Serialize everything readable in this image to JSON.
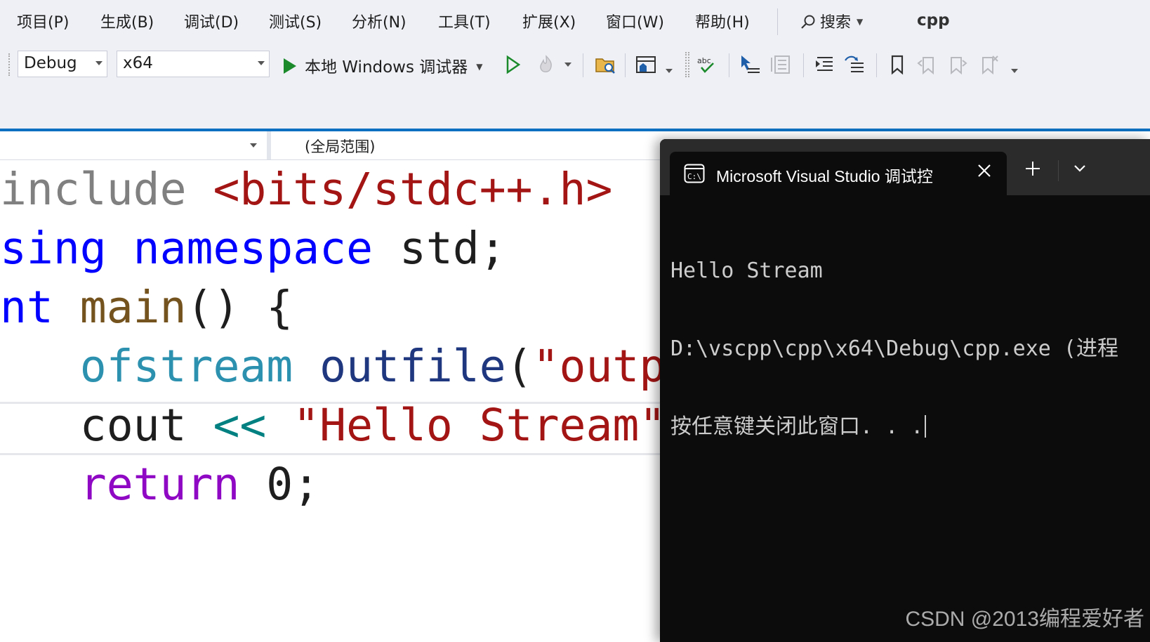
{
  "menu": {
    "items": [
      "项目(P)",
      "生成(B)",
      "调试(D)",
      "测试(S)",
      "分析(N)",
      "工具(T)",
      "扩展(X)",
      "窗口(W)",
      "帮助(H)"
    ],
    "search_label": "搜索",
    "solution_name": "cpp"
  },
  "toolbar": {
    "config_value": "Debug",
    "platform_value": "x64",
    "debugger_label": "本地 Windows 调试器",
    "icons": [
      "start-without-debugging-icon",
      "hot-reload-icon",
      "open-folder-icon",
      "window-layout-icon",
      "spell-check-icon",
      "set-next-statement-icon",
      "show-next-statement-icon",
      "indent-icon",
      "comment-icon",
      "bookmark-icon",
      "prev-bookmark-icon",
      "next-bookmark-icon",
      "clear-bookmarks-icon"
    ]
  },
  "navbar": {
    "scope": "(全局范围)"
  },
  "editor": {
    "lines": [
      [
        {
          "t": "include ",
          "c": "pre"
        },
        {
          "t": "<bits/stdc++.h>",
          "c": "inc"
        }
      ],
      [
        {
          "t": "sing ",
          "c": "kw"
        },
        {
          "t": "namespace",
          "c": "kw"
        },
        {
          "t": " std;",
          "c": "plain"
        }
      ],
      [
        {
          "t": "nt",
          "c": "kw"
        },
        {
          "t": " ",
          "c": "plain"
        },
        {
          "t": "main",
          "c": "fn"
        },
        {
          "t": "() {",
          "c": "plain"
        }
      ],
      [
        {
          "t": "   ",
          "c": "plain"
        },
        {
          "t": "ofstream",
          "c": "type"
        },
        {
          "t": " ",
          "c": "plain"
        },
        {
          "t": "outfile",
          "c": "var"
        },
        {
          "t": "(",
          "c": "plain"
        },
        {
          "t": "\"outpu",
          "c": "str"
        }
      ],
      [
        {
          "t": "   cout ",
          "c": "plain"
        },
        {
          "t": "<<",
          "c": "op"
        },
        {
          "t": " ",
          "c": "plain"
        },
        {
          "t": "\"Hello Stream\"",
          "c": "str"
        },
        {
          "t": ";",
          "c": "plain"
        }
      ],
      [
        {
          "t": "   ",
          "c": "plain"
        },
        {
          "t": "return",
          "c": "ctl"
        },
        {
          "t": " 0;",
          "c": "plain"
        }
      ]
    ]
  },
  "terminal": {
    "tab_title": "Microsoft Visual Studio 调试控",
    "output": [
      "Hello Stream",
      "D:\\vscpp\\cpp\\x64\\Debug\\cpp.exe (进程",
      "按任意键关闭此窗口. . ."
    ]
  },
  "watermark": "CSDN @2013编程爱好者",
  "colors": {
    "accent": "#0e70c0",
    "run_green": "#1b8a2b",
    "terminal_bg": "#0c0c0c"
  }
}
